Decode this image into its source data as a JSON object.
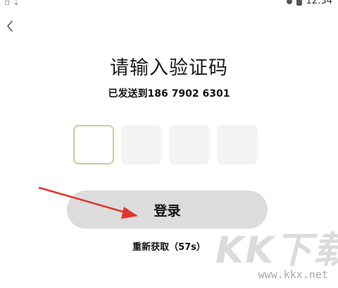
{
  "status_bar": {
    "time": "12:34"
  },
  "page": {
    "title": "请输入验证码",
    "sent_to_text": "已发送到186 7902 6301"
  },
  "code_input": {
    "length": 4,
    "values": [
      "",
      "",
      "",
      ""
    ],
    "active_index": 0,
    "colors": {
      "active_border": "#b7d88a",
      "inactive_bg": "#f3f3f3"
    }
  },
  "actions": {
    "login_label": "登录",
    "resend_label": "重新获取（57s）"
  },
  "watermark": {
    "brand": "KK下载",
    "url": "www.kkx.net"
  },
  "colors": {
    "button_bg": "#dcdcdc",
    "arrow": "#e0362c"
  }
}
